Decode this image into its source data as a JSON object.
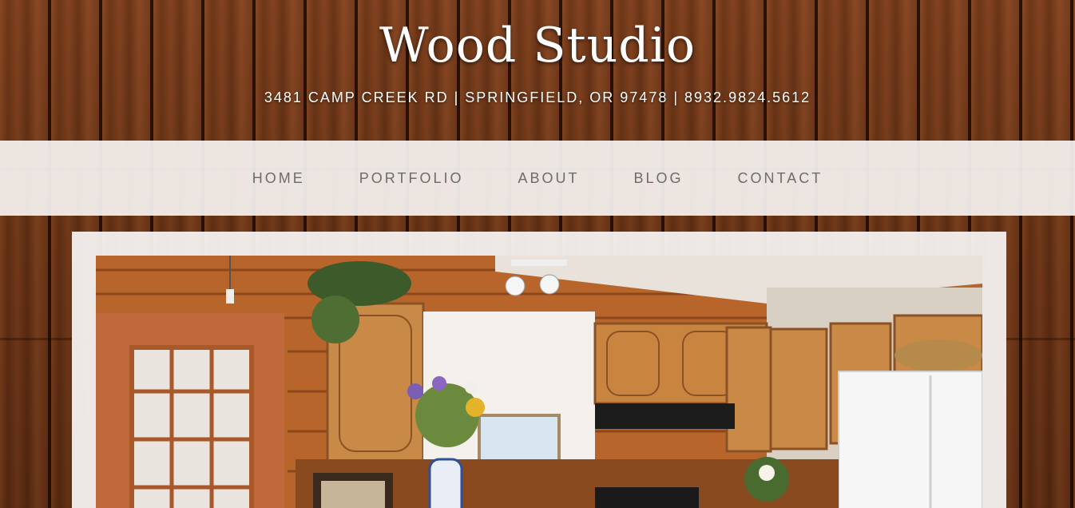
{
  "site": {
    "title": "Wood Studio",
    "tagline": "3481 CAMP CREEK RD | SPRINGFIELD, OR 97478 | 8932.9824.5612"
  },
  "nav": {
    "items": [
      {
        "label": "HOME"
      },
      {
        "label": "PORTFOLIO"
      },
      {
        "label": "ABOUT"
      },
      {
        "label": "BLOG"
      },
      {
        "label": "CONTACT"
      }
    ]
  },
  "colors": {
    "wood_background": "#6a3315",
    "nav_bar": "#f5f2f0",
    "nav_text": "#6c6c6c",
    "title_text": "#ffffff"
  }
}
